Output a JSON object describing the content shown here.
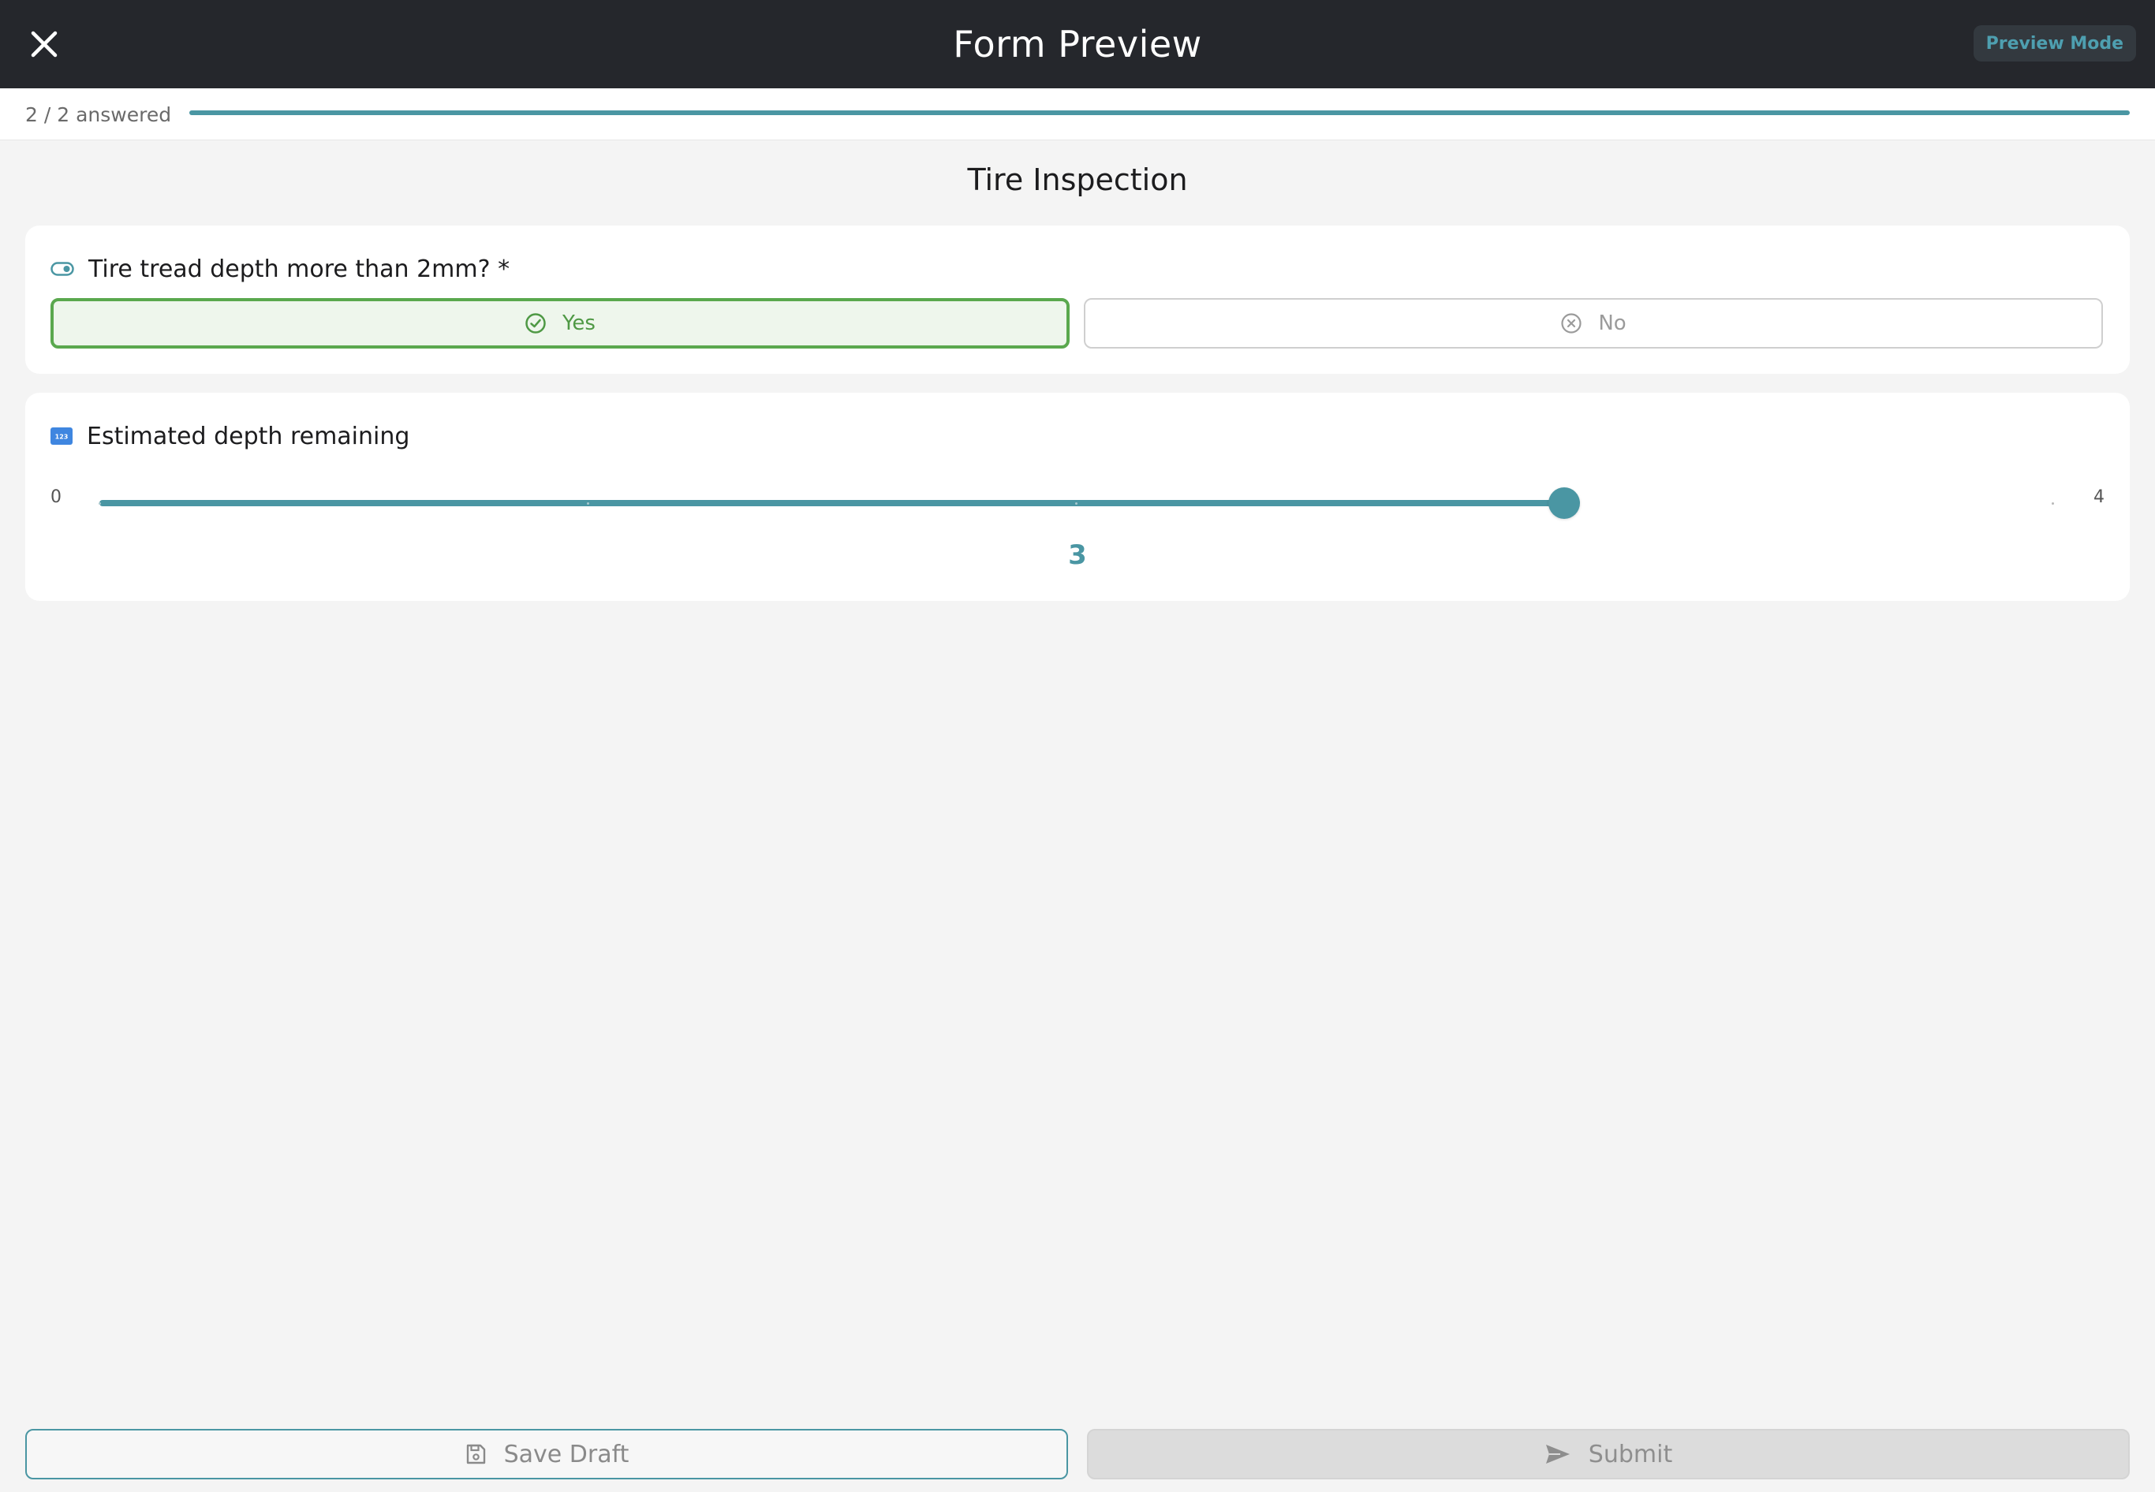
{
  "header": {
    "title": "Form Preview",
    "mode_badge": "Preview Mode"
  },
  "progress": {
    "text": "2 / 2 answered",
    "answered": 2,
    "total": 2,
    "fraction": 1.0,
    "color": "#4a96a3"
  },
  "form": {
    "title": "Tire Inspection"
  },
  "questions": [
    {
      "icon": "toggle-icon",
      "label": "Tire tread depth more than 2mm? *",
      "options": [
        {
          "label": "Yes",
          "icon": "check-circle-icon",
          "selected": true
        },
        {
          "label": "No",
          "icon": "x-circle-icon",
          "selected": false
        }
      ]
    },
    {
      "icon": "number-icon",
      "icon_text": "123",
      "label": "Estimated depth remaining",
      "slider": {
        "min_label": "0",
        "max_label": "4",
        "min": 0,
        "max": 4,
        "value": 3,
        "value_label": "3"
      }
    }
  ],
  "footer": {
    "save_label": "Save Draft",
    "save_icon": "save-icon",
    "submit_label": "Submit",
    "submit_icon": "send-icon"
  },
  "colors": {
    "accent": "#4a96a3",
    "success": "#5aa84e",
    "header_bg": "#25272c"
  }
}
